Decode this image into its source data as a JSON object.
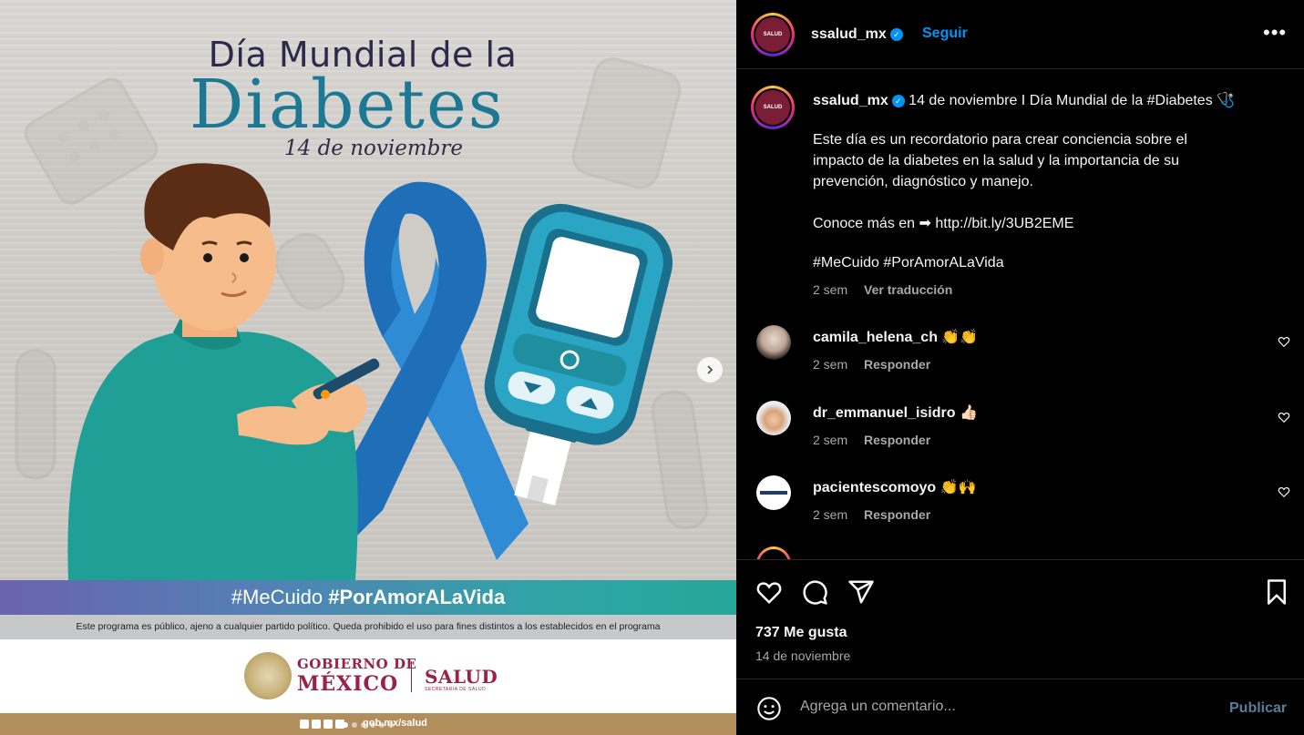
{
  "post_image": {
    "title_line1": "Día Mundial de la",
    "title_line2": "Diabetes",
    "date_line": "14 de noviembre",
    "hashtag_regular": "#MeCuido",
    "hashtag_bold": "#PorAmorALaVida",
    "disclaimer": "Este programa es público, ajeno a cualquier partido político. Queda prohibido el uso para fines distintos a los establecidos en el programa",
    "gov_line1": "GOBIERNO DE",
    "gov_line2": "MÉXICO",
    "salud": "SALUD",
    "salud_sub": "SECRETARÍA DE SALUD",
    "footer_url": "gob.mx/salud",
    "brand_color": "#9b2247",
    "accent_color": "#1d7893"
  },
  "header": {
    "username": "ssalud_mx",
    "verified": true,
    "follow_label": "Seguir",
    "more_icon": "more-horizontal-icon",
    "avatar_text": "SALUD"
  },
  "caption": {
    "username": "ssalud_mx",
    "first_line": "14 de noviembre I Día Mundial de la #Diabetes 🩺",
    "body_lines": [
      "Este día es un recordatorio para crear conciencia sobre el",
      "impacto de la diabetes en la salud y la importancia de su",
      "prevención, diagnóstico y manejo."
    ],
    "link_line": "Conoce más en ➡ http://bit.ly/3UB2EME",
    "hashtags": "#MeCuido #PorAmorALaVida",
    "time": "2 sem",
    "translate_label": "Ver traducción"
  },
  "comments": [
    {
      "username": "camila_helena_ch",
      "text": "👏👏",
      "time": "2 sem",
      "reply_label": "Responder"
    },
    {
      "username": "dr_emmanuel_isidro",
      "text": "👍🏻",
      "time": "2 sem",
      "reply_label": "Responder"
    },
    {
      "username": "pacientescomoyo",
      "text": "👏🙌",
      "time": "2 sem",
      "reply_label": "Responder"
    }
  ],
  "actions": {
    "likes_label": "737 Me gusta",
    "date": "14 de noviembre",
    "comment_placeholder": "Agrega un comentario...",
    "publish_label": "Publicar",
    "icons": [
      "heart-icon",
      "comment-icon",
      "share-icon",
      "bookmark-icon",
      "emoji-icon"
    ]
  },
  "colors": {
    "link_blue": "#0095f6",
    "muted": "#a8a8a8",
    "publish_disabled": "#5a7d99"
  }
}
